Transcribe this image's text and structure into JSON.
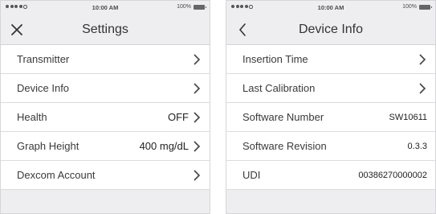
{
  "status": {
    "time": "10:00 AM",
    "battery": "100%"
  },
  "settings_screen": {
    "title": "Settings",
    "rows": [
      {
        "label": "Transmitter",
        "value": ""
      },
      {
        "label": "Device Info",
        "value": ""
      },
      {
        "label": "Health",
        "value": "OFF"
      },
      {
        "label": "Graph Height",
        "value": "400 mg/dL"
      },
      {
        "label": "Dexcom Account",
        "value": ""
      }
    ]
  },
  "device_info_screen": {
    "title": "Device Info",
    "rows": [
      {
        "label": "Insertion Time",
        "value": ""
      },
      {
        "label": "Last Calibration",
        "value": ""
      },
      {
        "label": "Software Number",
        "value": "SW10611"
      },
      {
        "label": "Software Revision",
        "value": "0.3.3"
      },
      {
        "label": "UDI",
        "value": "00386270000002"
      }
    ]
  },
  "icons": {
    "close": "close-icon",
    "back": "back-chevron-icon",
    "disclosure": "chevron-right-icon"
  }
}
